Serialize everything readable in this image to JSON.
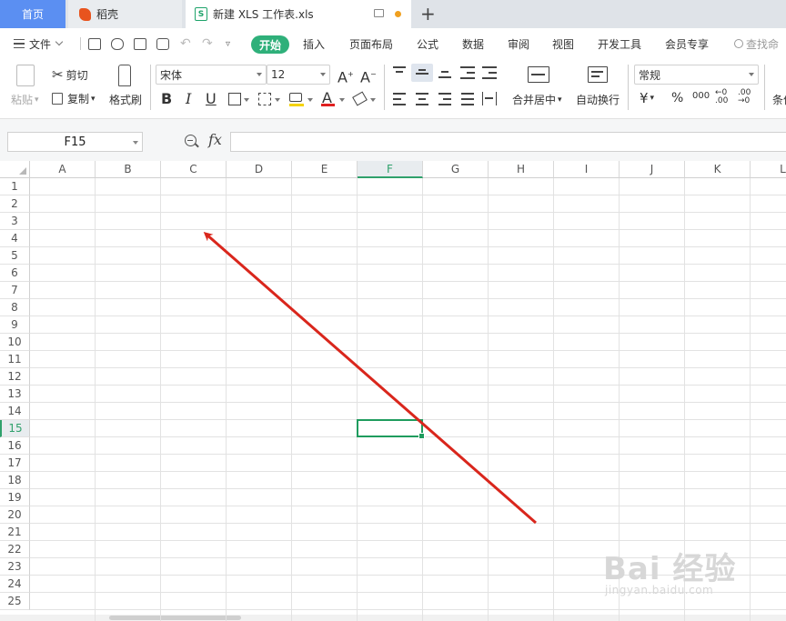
{
  "tabs": {
    "home": "首页",
    "daoke": "稻壳",
    "document": "新建 XLS 工作表.xls",
    "add": "+"
  },
  "menu": {
    "file": "文件",
    "kaishi": "开始",
    "items": [
      "插入",
      "页面布局",
      "公式",
      "数据",
      "审阅",
      "视图",
      "开发工具",
      "会员专享"
    ],
    "search": "查找命"
  },
  "ribbon": {
    "paste": "粘贴",
    "cut": "剪切",
    "copy": "复制",
    "format_painter": "格式刷",
    "font_name": "宋体",
    "font_size": "12",
    "merge_center": "合并居中",
    "wrap_text": "自动换行",
    "number_format": "常规",
    "currency": "¥",
    "percent": "%",
    "thousands": "000",
    "inc_decimal": "←0 .00",
    "dec_decimal": ".00 →0",
    "conditional": "条件"
  },
  "formula_bar": {
    "name_box": "F15",
    "fx": "fx",
    "content": ""
  },
  "sheet": {
    "columns": [
      "A",
      "B",
      "C",
      "D",
      "E",
      "F",
      "G",
      "H",
      "I",
      "J",
      "K",
      "L"
    ],
    "rows": [
      "1",
      "2",
      "3",
      "4",
      "5",
      "6",
      "7",
      "8",
      "9",
      "10",
      "11",
      "12",
      "13",
      "14",
      "15",
      "16",
      "17",
      "18",
      "19",
      "20",
      "21",
      "22",
      "23",
      "24",
      "25"
    ],
    "selected_column": "F",
    "selected_row": "15",
    "annotation_color": "#d9261c"
  },
  "watermark": {
    "main": "Bai 经验",
    "sub": "jingyan.baidu.com"
  },
  "colors": {
    "accent": "#2fb07a",
    "home_tab": "#5b8ff2",
    "selection": "#1f9c5e"
  }
}
